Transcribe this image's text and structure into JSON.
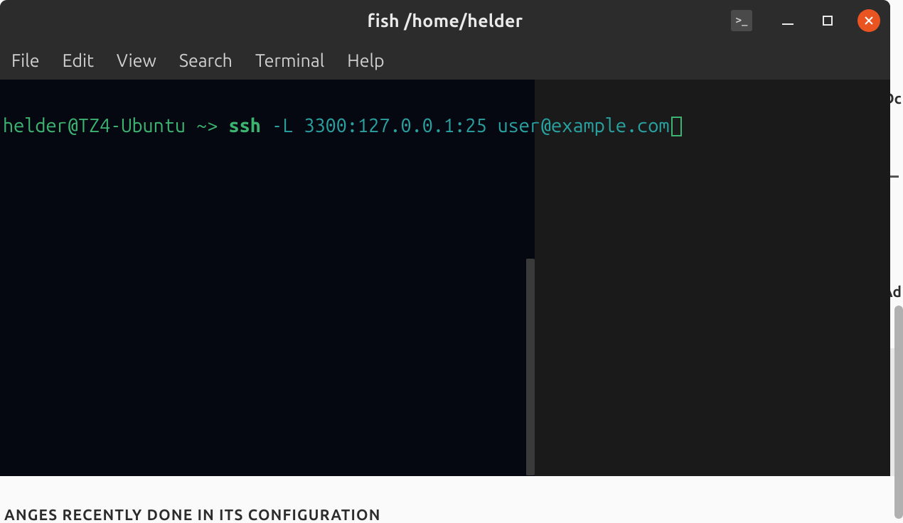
{
  "window": {
    "title": "fish  /home/helder"
  },
  "menubar": {
    "items": [
      "File",
      "Edit",
      "View",
      "Search",
      "Terminal",
      "Help"
    ]
  },
  "terminal": {
    "prompt_user_host": "helder@TZ4-Ubuntu",
    "prompt_path": "~",
    "prompt_symbol": ">",
    "command": "ssh",
    "args": "-L 3300:127.0.0.1:25 user@example.com"
  },
  "background": {
    "bottom_fragment": "ANGES RECENTLY DONE IN ITS CONFIGURATION",
    "right_fragment_1": "Dc",
    "right_fragment_2": "Ad"
  },
  "app_icon_glyph": ">_"
}
